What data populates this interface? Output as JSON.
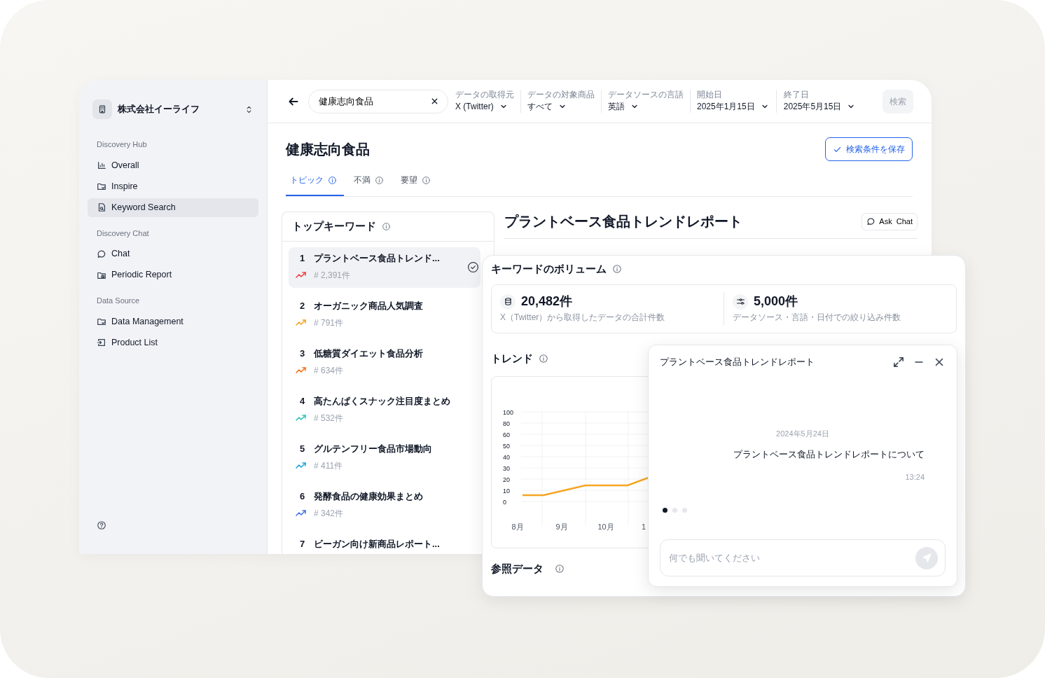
{
  "sidebar": {
    "org": {
      "name": "株式会社イーライフ"
    },
    "sections": [
      {
        "title": "Discovery Hub",
        "items": [
          {
            "label": "Overall",
            "kind": "chart",
            "selected": false
          },
          {
            "label": "Inspire",
            "kind": "folder",
            "selected": false
          },
          {
            "label": "Keyword Search",
            "kind": "search-doc",
            "selected": true
          }
        ]
      },
      {
        "title": "Discovery Chat",
        "items": [
          {
            "label": "Chat",
            "kind": "chat",
            "selected": false
          },
          {
            "label": "Periodic Report",
            "kind": "clock-folder",
            "selected": false
          }
        ]
      },
      {
        "title": "Data Source",
        "items": [
          {
            "label": "Data Management",
            "kind": "folder",
            "selected": false
          },
          {
            "label": "Product List",
            "kind": "import",
            "selected": false
          }
        ]
      }
    ]
  },
  "header": {
    "search": {
      "value": "健康志向食品"
    },
    "filters": [
      {
        "label": "データの取得元",
        "value": "X (Twitter)"
      },
      {
        "label": "データの対象商品",
        "value": "すべて"
      },
      {
        "label": "データソースの言語",
        "value": "英語"
      },
      {
        "label": "開始日",
        "value": "2025年1月15日"
      },
      {
        "label": "終了日",
        "value": "2025年5月15日"
      }
    ],
    "search_button": {
      "label": "検索",
      "disabled": true
    }
  },
  "page": {
    "title": "健康志向食品",
    "save_button": "検索条件を保存",
    "tabs": [
      {
        "label": "トピック",
        "selected": true
      },
      {
        "label": "不満",
        "selected": false
      },
      {
        "label": "要望",
        "selected": false
      }
    ]
  },
  "top_keywords": {
    "title": "トップキーワード",
    "items": [
      {
        "rank": "1",
        "title": "プラントベース食品トレンド...",
        "count": "# 2,391件",
        "color": "#ef4444",
        "selected": true
      },
      {
        "rank": "2",
        "title": "オーガニック商品人気調査",
        "count": "# 791件",
        "color": "#f5a524",
        "selected": false
      },
      {
        "rank": "3",
        "title": "低糖質ダイエット食品分析",
        "count": "# 634件",
        "color": "#f97316",
        "selected": false
      },
      {
        "rank": "4",
        "title": "高たんぱくスナック注目度まとめ",
        "count": "# 532件",
        "color": "#2ec4b6",
        "selected": false
      },
      {
        "rank": "5",
        "title": "グルテンフリー食品市場動向",
        "count": "# 411件",
        "color": "#22a6d6",
        "selected": false
      },
      {
        "rank": "6",
        "title": "発酵食品の健康効果まとめ",
        "count": "# 342件",
        "color": "#4a72e8",
        "selected": false
      },
      {
        "rank": "7",
        "title": "ビーガン向け新商品レポート...",
        "selected": false
      }
    ]
  },
  "report": {
    "title": "プラントベース食品トレンドレポート",
    "ask_chat": "Ask  Chat"
  },
  "volume": {
    "title": "キーワードのボリューム",
    "stats": [
      {
        "kind": "database",
        "value": "20,482件",
        "caption": "X（Twitter）から取得したデータの合計件数"
      },
      {
        "kind": "filter",
        "value": "5,000件",
        "caption": "データソース・言語・日付での絞り込み件数"
      }
    ],
    "trend": {
      "title": "トレンド",
      "y_labels": [
        "100",
        "80",
        "60",
        "50",
        "40",
        "30",
        "20",
        "10",
        "0"
      ],
      "x_labels": [
        "8月",
        "9月",
        "10月",
        "1"
      ]
    },
    "reference_title": "参照データ"
  },
  "chat": {
    "title": "プラントベース食品トレンドレポート",
    "date": "2024年5月24日",
    "message": "プラントベース食品トレンドレポートについて",
    "time": "13:24",
    "dots": [
      {
        "selected": true
      },
      {
        "selected": false
      },
      {
        "selected": false
      }
    ],
    "input": {
      "placeholder": "何でも聞いてください"
    },
    "send_disabled": true
  }
}
